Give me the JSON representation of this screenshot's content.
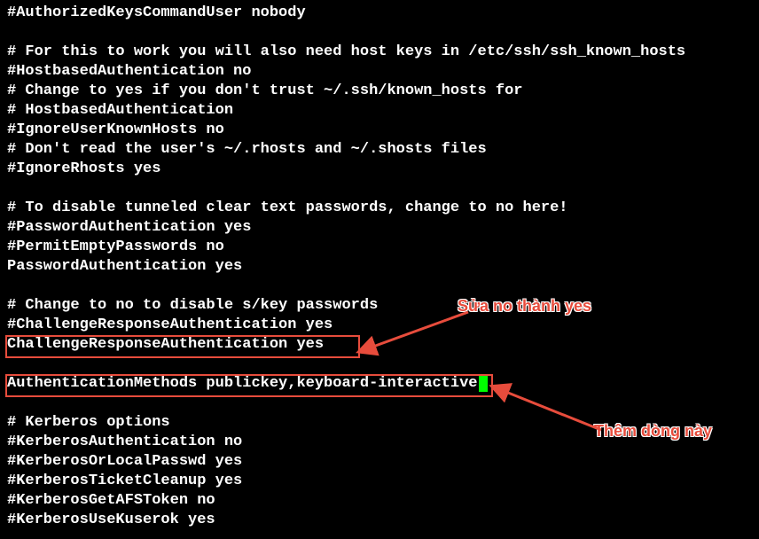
{
  "lines": [
    "#AuthorizedKeysCommandUser nobody",
    "",
    "# For this to work you will also need host keys in /etc/ssh/ssh_known_hosts",
    "#HostbasedAuthentication no",
    "# Change to yes if you don't trust ~/.ssh/known_hosts for",
    "# HostbasedAuthentication",
    "#IgnoreUserKnownHosts no",
    "# Don't read the user's ~/.rhosts and ~/.shosts files",
    "#IgnoreRhosts yes",
    "",
    "# To disable tunneled clear text passwords, change to no here!",
    "#PasswordAuthentication yes",
    "#PermitEmptyPasswords no",
    "PasswordAuthentication yes",
    "",
    "# Change to no to disable s/key passwords",
    "#ChallengeResponseAuthentication yes",
    "ChallengeResponseAuthentication yes",
    "",
    "AuthenticationMethods publickey,keyboard-interactive",
    "",
    "# Kerberos options",
    "#KerberosAuthentication no",
    "#KerberosOrLocalPasswd yes",
    "#KerberosTicketCleanup yes",
    "#KerberosGetAFSToken no",
    "#KerberosUseKuserok yes"
  ],
  "cursor_line_index": 19,
  "annotations": {
    "edit_label": "Sửa no thành yes",
    "add_label": "Thêm dòng này"
  },
  "colors": {
    "highlight_box": "#e74c3c",
    "cursor": "#00ff00",
    "background": "#000000",
    "text": "#ffffff"
  }
}
